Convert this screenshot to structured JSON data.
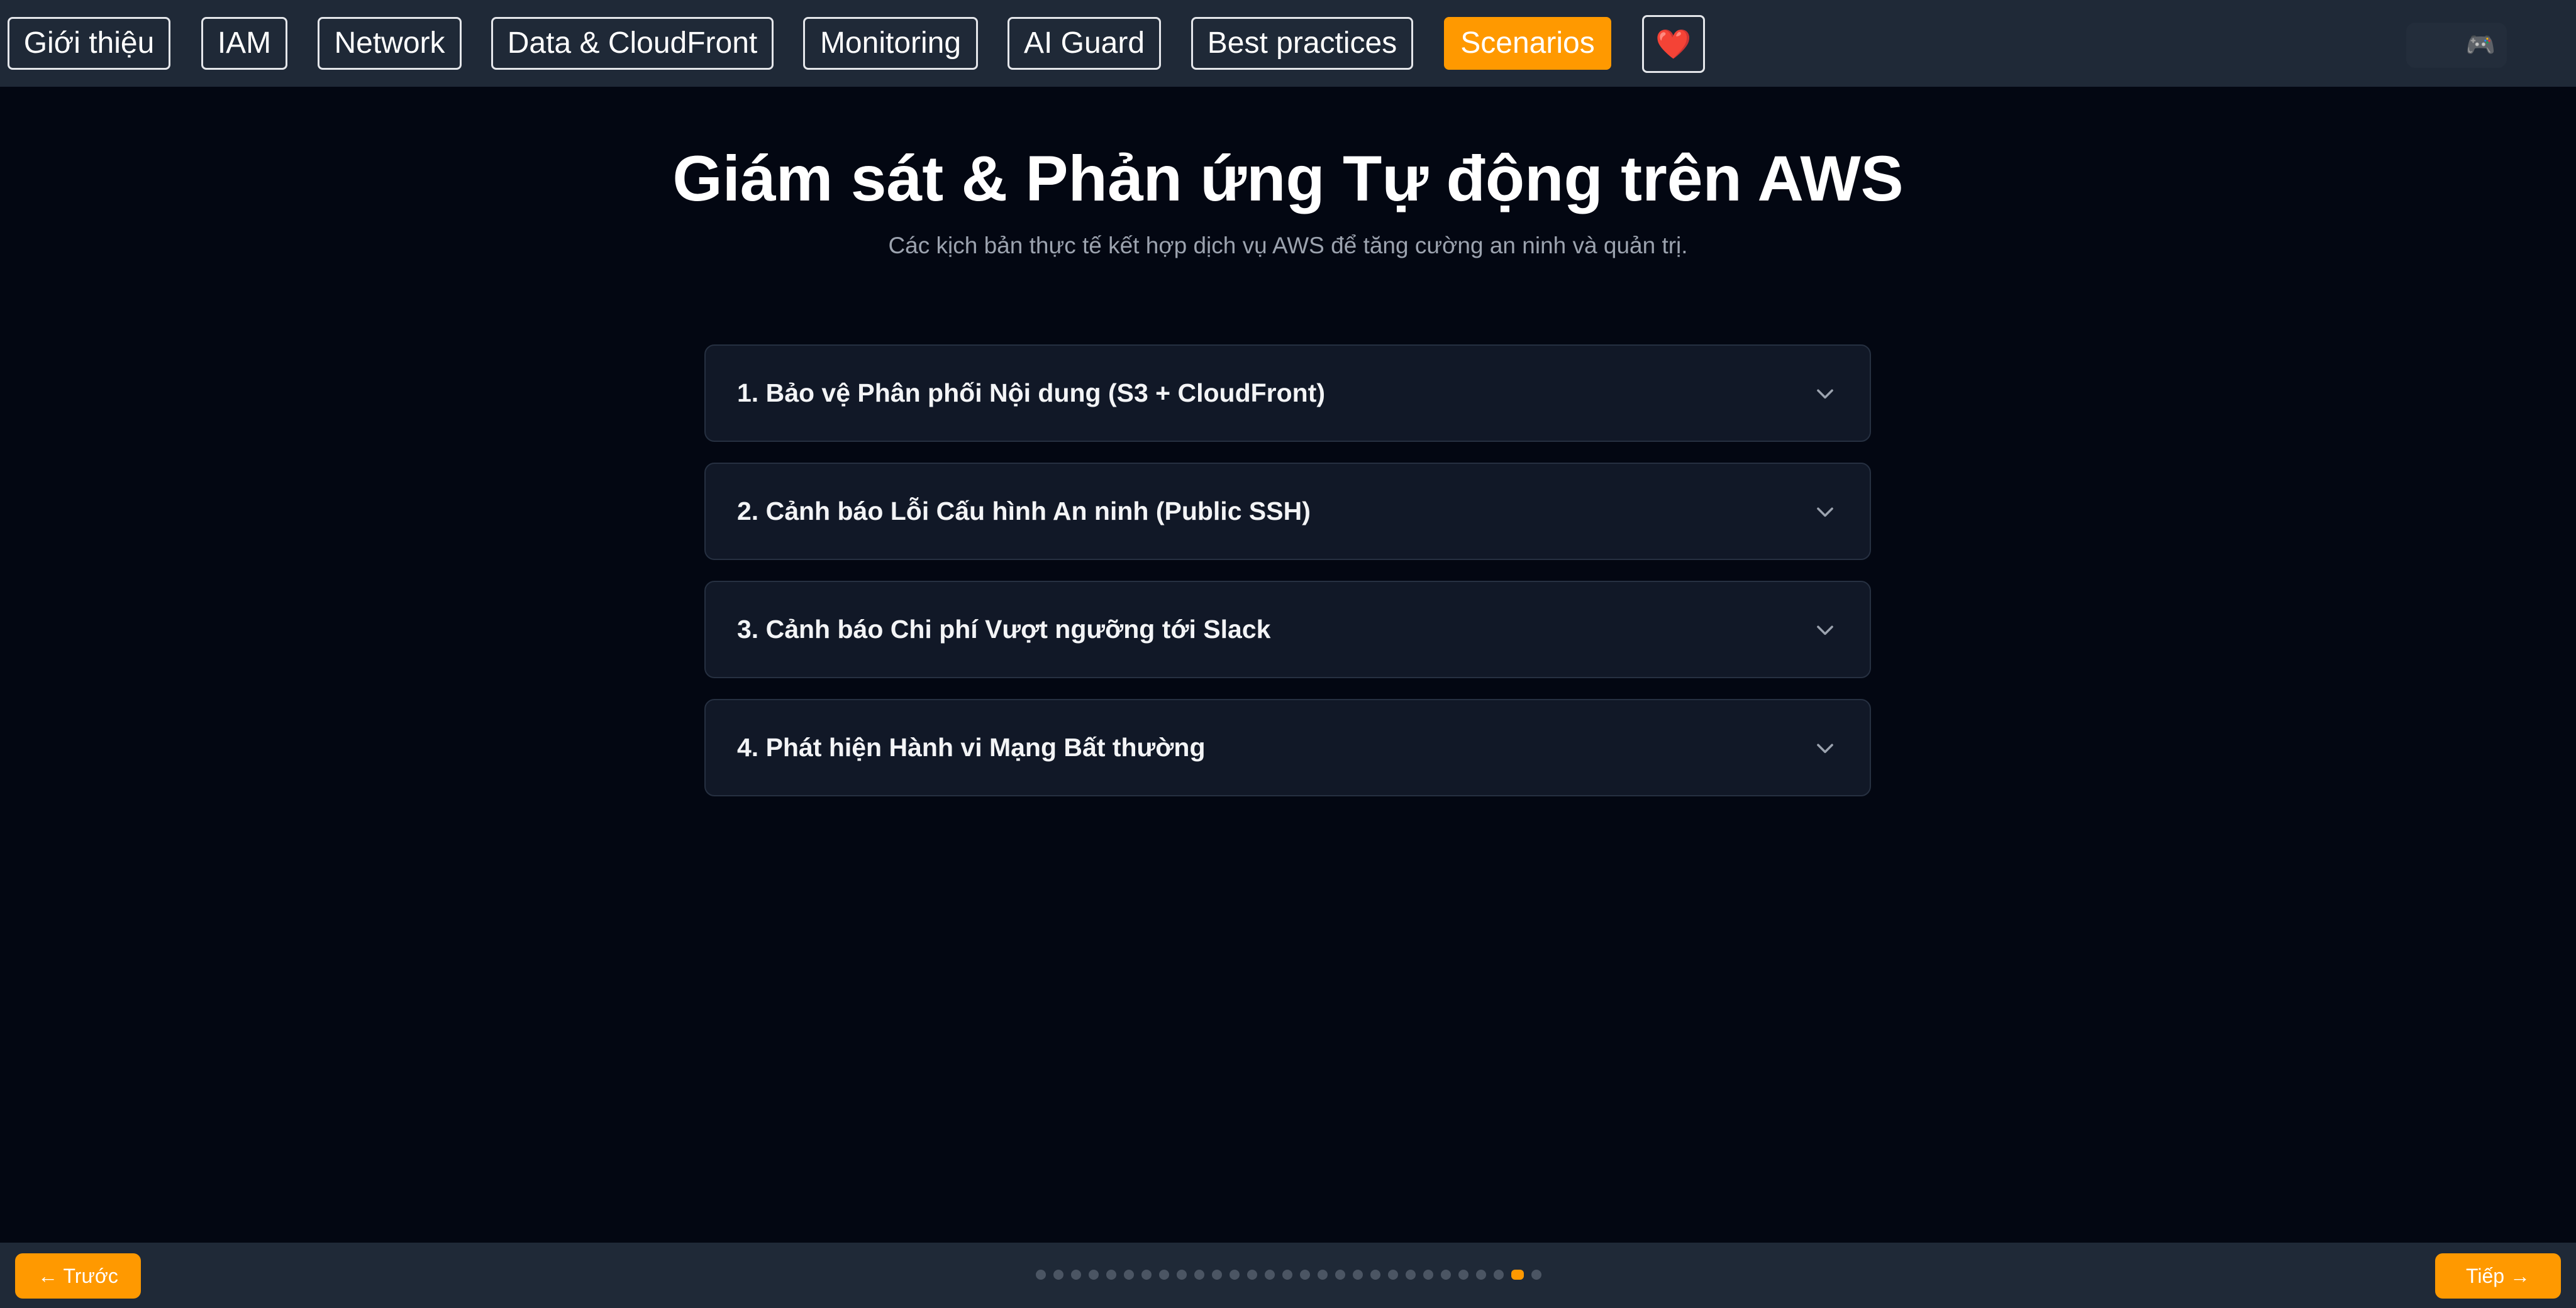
{
  "nav": {
    "items": [
      {
        "label": "Giới thiệu",
        "active": false
      },
      {
        "label": "IAM",
        "active": false
      },
      {
        "label": "Network",
        "active": false
      },
      {
        "label": "Data & CloudFront",
        "active": false
      },
      {
        "label": "Monitoring",
        "active": false
      },
      {
        "label": "AI Guard",
        "active": false
      },
      {
        "label": "Best practices",
        "active": false
      },
      {
        "label": "Scenarios",
        "active": true
      }
    ],
    "heart_label": "❤️",
    "game_icon": "🎮"
  },
  "header": {
    "title": "Giám sát & Phản ứng Tự động trên AWS",
    "subtitle": "Các kịch bản thực tế kết hợp dịch vụ AWS để tăng cường an ninh và quản trị."
  },
  "scenarios": [
    {
      "title": "1. Bảo vệ Phân phối Nội dung (S3 + CloudFront)",
      "expanded": false
    },
    {
      "title": "2. Cảnh báo Lỗi Cấu hình An ninh (Public SSH)",
      "expanded": false
    },
    {
      "title": "3. Cảnh báo Chi phí Vượt ngưỡng tới Slack",
      "expanded": false
    },
    {
      "title": "4. Phát hiện Hành vi Mạng Bất thường",
      "expanded": false
    }
  ],
  "footer": {
    "prev_label": "← Trước",
    "next_label": "Tiếp →",
    "slide_count": 29,
    "current_slide": 28
  },
  "colors": {
    "accent": "#ff9900",
    "background": "#030712",
    "bar": "#1f2937",
    "card": "#111827"
  }
}
